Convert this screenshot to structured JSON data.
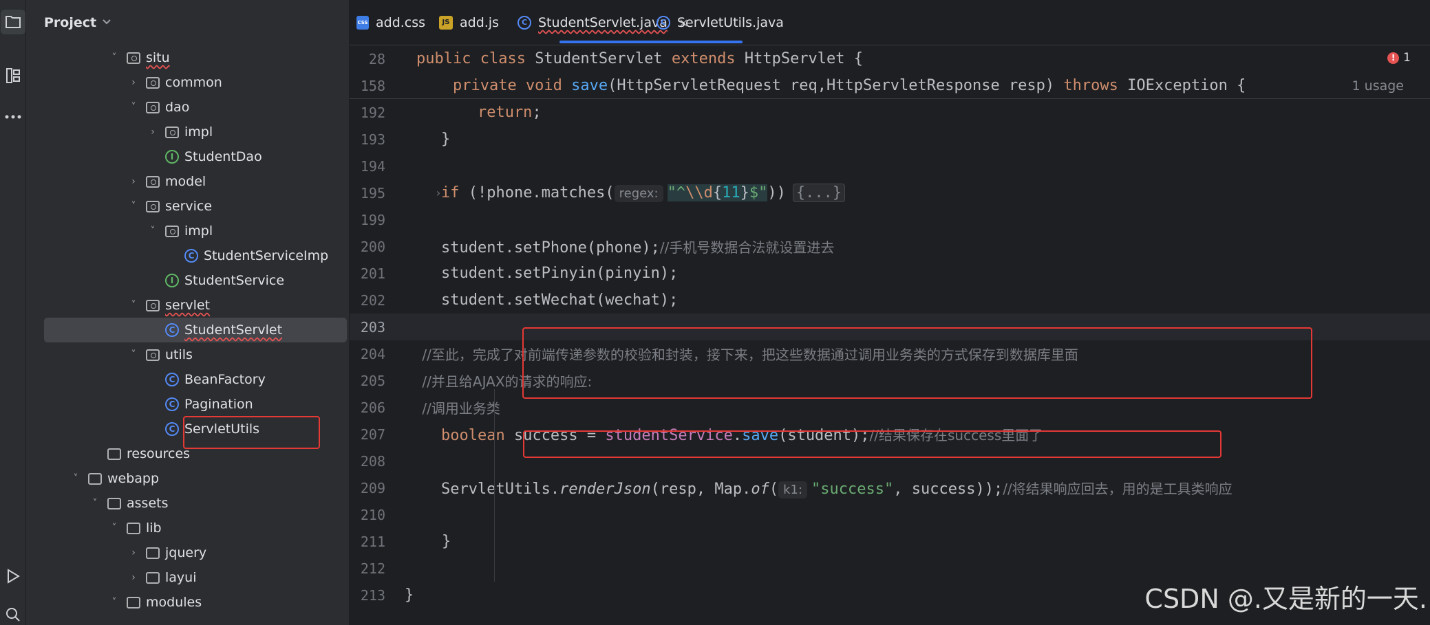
{
  "activity": {
    "items": [
      "folder-icon",
      "structure-icon",
      "more-icon",
      "run-icon",
      "search-icon"
    ]
  },
  "project": {
    "title": "Project",
    "tree": [
      {
        "label": "situ",
        "type": "pkg",
        "arrow": "˅",
        "wavy": true
      },
      {
        "label": "common",
        "type": "pkg",
        "arrow": "›"
      },
      {
        "label": "dao",
        "type": "pkg",
        "arrow": "˅"
      },
      {
        "label": "impl",
        "type": "pkg",
        "arrow": "›"
      },
      {
        "label": "StudentDao",
        "type": "iface"
      },
      {
        "label": "model",
        "type": "pkg",
        "arrow": "›"
      },
      {
        "label": "service",
        "type": "pkg",
        "arrow": "˅"
      },
      {
        "label": "impl",
        "type": "pkg",
        "arrow": "˅"
      },
      {
        "label": "StudentServiceImp",
        "type": "class"
      },
      {
        "label": "StudentService",
        "type": "iface"
      },
      {
        "label": "servlet",
        "type": "pkg",
        "arrow": "˅",
        "wavy": true
      },
      {
        "label": "StudentServlet",
        "type": "class",
        "selected": true,
        "wavy": true
      },
      {
        "label": "utils",
        "type": "pkg",
        "arrow": "˅"
      },
      {
        "label": "BeanFactory",
        "type": "class"
      },
      {
        "label": "Pagination",
        "type": "class"
      },
      {
        "label": "ServletUtils",
        "type": "class"
      },
      {
        "label": "resources",
        "type": "folder"
      },
      {
        "label": "webapp",
        "type": "folder",
        "arrow": "˅"
      },
      {
        "label": "assets",
        "type": "folder",
        "arrow": "˅"
      },
      {
        "label": "lib",
        "type": "folder",
        "arrow": "˅"
      },
      {
        "label": "jquery",
        "type": "folder",
        "arrow": "›"
      },
      {
        "label": "layui",
        "type": "folder",
        "arrow": "›"
      },
      {
        "label": "modules",
        "type": "folder",
        "arrow": "˅"
      }
    ]
  },
  "tabs": [
    {
      "label": "add.css",
      "icon": "css-file-icon"
    },
    {
      "label": "add.js",
      "icon": "js-file-icon"
    },
    {
      "label": "StudentServlet.java",
      "icon": "class-icon",
      "active": true,
      "close": "×"
    },
    {
      "label": "ServletUtils.java",
      "icon": "class-icon"
    }
  ],
  "editor": {
    "error_count": "1",
    "error_glyph": "!",
    "usage_hint": "1 usage",
    "sticky": [
      {
        "ln": "28",
        "parts": [
          [
            "kw",
            "public class "
          ],
          [
            "plain",
            "StudentServlet "
          ],
          [
            "kw",
            "extends "
          ],
          [
            "plain",
            "HttpServlet {"
          ]
        ]
      },
      {
        "ln": "158",
        "parts": [
          [
            "kw",
            "    private void "
          ],
          [
            "fn",
            "save"
          ],
          [
            "plain",
            "(HttpServletRequest req,HttpServletResponse resp) "
          ],
          [
            "kw",
            "throws "
          ],
          [
            "plain",
            "IOException {"
          ]
        ]
      }
    ],
    "lines": [
      {
        "ln": "192",
        "parts": [
          [
            "kw",
            "        return"
          ],
          [
            "plain",
            ";"
          ]
        ]
      },
      {
        "ln": "193",
        "parts": [
          [
            "plain",
            "    }"
          ]
        ]
      },
      {
        "ln": "194",
        "parts": []
      },
      {
        "ln": "199",
        "parts": []
      },
      {
        "ln": "200",
        "parts": [
          [
            "plain",
            "    student.setPhone(phone);"
          ],
          [
            "cmt",
            "//手机号数据合法就设置进去"
          ]
        ]
      },
      {
        "ln": "201",
        "parts": [
          [
            "plain",
            "    student.setPinyin(pinyin);"
          ]
        ]
      },
      {
        "ln": "202",
        "parts": [
          [
            "plain",
            "    student.setWechat(wechat);"
          ]
        ]
      },
      {
        "ln": "203",
        "parts": []
      },
      {
        "ln": "204",
        "parts": [
          [
            "cmt",
            "    //至此，完成了对前端传递参数的校验和封装，接下来，把这些数据通过调用业务类的方式保存到数据库里面"
          ]
        ]
      },
      {
        "ln": "205",
        "parts": [
          [
            "cmt",
            "    //并且给AJAX的请求的响应:"
          ]
        ]
      },
      {
        "ln": "206",
        "parts": [
          [
            "cmt",
            "    //调用业务类"
          ]
        ]
      },
      {
        "ln": "207",
        "parts": [
          [
            "kw",
            "    boolean "
          ],
          [
            "plain",
            "success = "
          ],
          [
            "field",
            "studentService"
          ],
          [
            "plain",
            "."
          ],
          [
            "fn",
            "save"
          ],
          [
            "plain",
            "(student);"
          ],
          [
            "cmt",
            "//结果保存在success里面了"
          ]
        ]
      },
      {
        "ln": "208",
        "parts": []
      },
      {
        "ln": "210",
        "parts": []
      },
      {
        "ln": "211",
        "parts": [
          [
            "plain",
            "}"
          ]
        ]
      },
      {
        "ln": "212",
        "parts": []
      },
      {
        "ln": "213",
        "parts": [
          [
            "plain",
            "}"
          ]
        ]
      }
    ],
    "line195": {
      "ln": "195",
      "fold": "›",
      "prefix_kw": "    if ",
      "prefix": "(!phone.matches(",
      "hint": "regex:",
      "q1": "\"^",
      "esc": "\\\\d",
      "brace_open": "{",
      "num": "11",
      "brace_close": "}",
      "dollar": "$\"",
      "suffix": "))",
      "folded": "{...}"
    },
    "line209": {
      "ln": "209",
      "prefix": "    ServletUtils.",
      "method": "renderJson",
      "mid": "(resp, Map.",
      "of": "of",
      "paren": "(",
      "hint": "k1:",
      "str": "\"success\"",
      "suffix": ", success));",
      "comment": "//将结果响应回去，用的是工具类响应"
    }
  },
  "watermark": "CSDN @.又是新的一天."
}
